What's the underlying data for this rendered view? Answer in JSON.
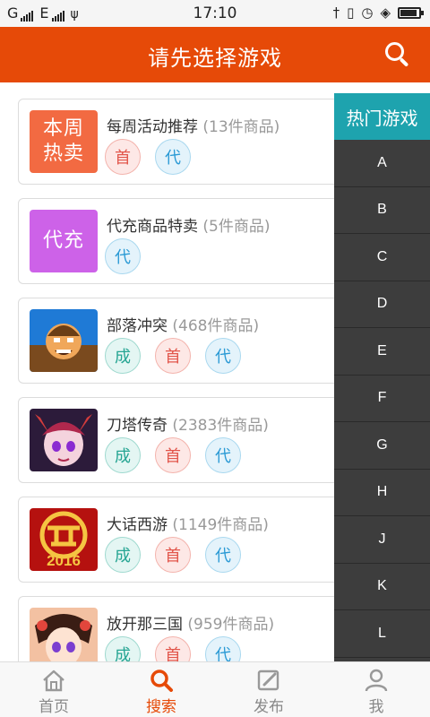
{
  "status_bar": {
    "network_1": "G",
    "network_2": "E",
    "time": "17:10"
  },
  "header": {
    "title": "请先选择游戏"
  },
  "games": [
    {
      "name": "每周活动推荐",
      "count": "(13件商品)",
      "thumb_text": [
        "本周",
        "热卖"
      ],
      "thumb_color": "#f26a42",
      "badges": [
        "首",
        "代"
      ]
    },
    {
      "name": "代充商品特卖",
      "count": "(5件商品)",
      "thumb_text": [
        "代充"
      ],
      "thumb_color": "#cd62e8",
      "badges": [
        "代"
      ]
    },
    {
      "name": "部落冲突",
      "count": "(468件商品)",
      "thumb_icon": "clash-of-clans-icon",
      "badges": [
        "成",
        "首",
        "代"
      ]
    },
    {
      "name": "刀塔传奇",
      "count": "(2383件商品)",
      "thumb_icon": "dota-legend-icon",
      "badges": [
        "成",
        "首",
        "代"
      ]
    },
    {
      "name": "大话西游",
      "count": "(1149件商品)",
      "thumb_icon": "dahua-xiyou-icon",
      "badges": [
        "成",
        "首",
        "代"
      ]
    },
    {
      "name": "放开那三国",
      "count": "(959件商品)",
      "thumb_icon": "fangkai-sanguo-icon",
      "badges": [
        "成",
        "首",
        "代"
      ]
    }
  ],
  "thumb_logo_text": "2016",
  "index_bar": {
    "hot_label": "热门游戏",
    "letters": [
      "A",
      "B",
      "C",
      "D",
      "E",
      "F",
      "G",
      "H",
      "J",
      "K",
      "L"
    ]
  },
  "tabs": [
    {
      "label": "首页",
      "icon": "home-icon"
    },
    {
      "label": "搜索",
      "icon": "search-icon",
      "active": true
    },
    {
      "label": "发布",
      "icon": "edit-icon"
    },
    {
      "label": "我",
      "icon": "user-icon"
    }
  ],
  "colors": {
    "brand": "#e64a08",
    "hot_accent": "#1ea3ae",
    "index_bg": "#3d3d3d"
  }
}
